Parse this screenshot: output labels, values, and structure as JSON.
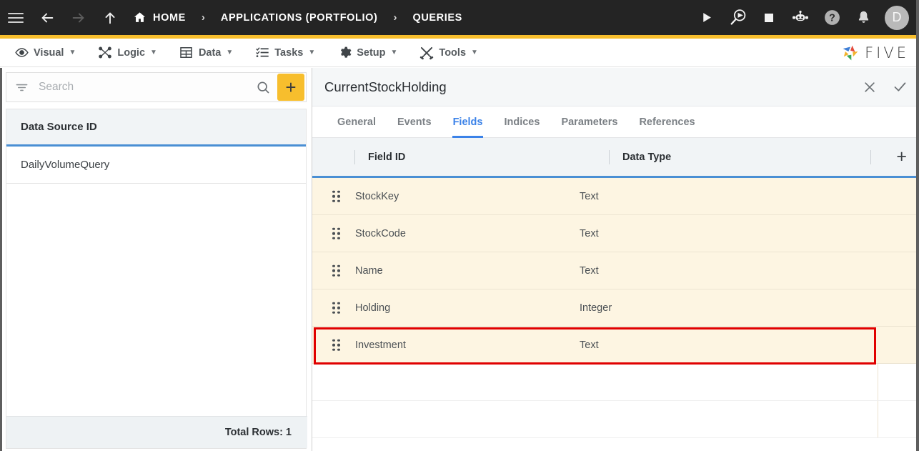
{
  "topbar": {
    "menu_icon": "hamburger-icon",
    "nav": [
      {
        "name": "back",
        "icon": "arrow-left-icon",
        "enabled": true
      },
      {
        "name": "forward",
        "icon": "arrow-right-icon",
        "enabled": false
      },
      {
        "name": "up",
        "icon": "arrow-up-icon",
        "enabled": true
      }
    ],
    "breadcrumbs": [
      {
        "label": "HOME",
        "icon": "home-icon"
      },
      {
        "label": "APPLICATIONS (PORTFOLIO)",
        "icon": ""
      },
      {
        "label": "QUERIES",
        "icon": ""
      }
    ],
    "separator": "›",
    "actions": [
      {
        "name": "run-button",
        "icon": "play-icon"
      },
      {
        "name": "debug-button",
        "icon": "debug-magnifier-play-icon"
      },
      {
        "name": "stop-button",
        "icon": "stop-square-icon"
      },
      {
        "name": "assistant-button",
        "icon": "robot-icon"
      },
      {
        "name": "help-button",
        "icon": "question-circle-icon"
      },
      {
        "name": "notifications-button",
        "icon": "bell-icon"
      }
    ],
    "avatar_initial": "D"
  },
  "menubar": {
    "items": [
      {
        "label": "Visual",
        "icon": "eye-icon",
        "caret": "▼"
      },
      {
        "label": "Logic",
        "icon": "flow-nodes-icon",
        "caret": "▼"
      },
      {
        "label": "Data",
        "icon": "table-grid-icon",
        "caret": "▼"
      },
      {
        "label": "Tasks",
        "icon": "checklist-icon",
        "caret": "▼"
      },
      {
        "label": "Setup",
        "icon": "gear-icon",
        "caret": "▼"
      },
      {
        "label": "Tools",
        "icon": "tools-cross-icon",
        "caret": "▼"
      }
    ],
    "brand": {
      "text": "FIVE",
      "logo": "five-pinwheel-logo"
    }
  },
  "sidebar": {
    "search": {
      "value": "",
      "placeholder": "Search"
    },
    "filter_icon": "filter-icon",
    "search_icon": "search-icon",
    "add_label": "+",
    "list_header": "Data Source ID",
    "rows": [
      {
        "label": "DailyVolumeQuery"
      }
    ],
    "footer": "Total Rows: 1"
  },
  "detail": {
    "title": "CurrentStockHolding",
    "close_icon": "close-icon",
    "confirm_icon": "check-icon",
    "tabs": [
      {
        "label": "General",
        "active": false
      },
      {
        "label": "Events",
        "active": false
      },
      {
        "label": "Fields",
        "active": true
      },
      {
        "label": "Indices",
        "active": false
      },
      {
        "label": "Parameters",
        "active": false
      },
      {
        "label": "References",
        "active": false
      }
    ],
    "grid": {
      "columns": [
        "Field ID",
        "Data Type"
      ],
      "add_label": "+",
      "rows": [
        {
          "field_id": "StockKey",
          "data_type": "Text",
          "highlighted": false
        },
        {
          "field_id": "StockCode",
          "data_type": "Text",
          "highlighted": false
        },
        {
          "field_id": "Name",
          "data_type": "Text",
          "highlighted": false
        },
        {
          "field_id": "Holding",
          "data_type": "Integer",
          "highlighted": false
        },
        {
          "field_id": "Investment",
          "data_type": "Text",
          "highlighted": true
        }
      ]
    }
  },
  "colors": {
    "topbar_bg": "#242424",
    "accent_yellow": "#F7BE2D",
    "tab_active_blue": "#3b82e8",
    "grid_header_underline": "#4a8fd4",
    "row_cream": "#FDF5E2",
    "highlight_red": "#e00000"
  }
}
